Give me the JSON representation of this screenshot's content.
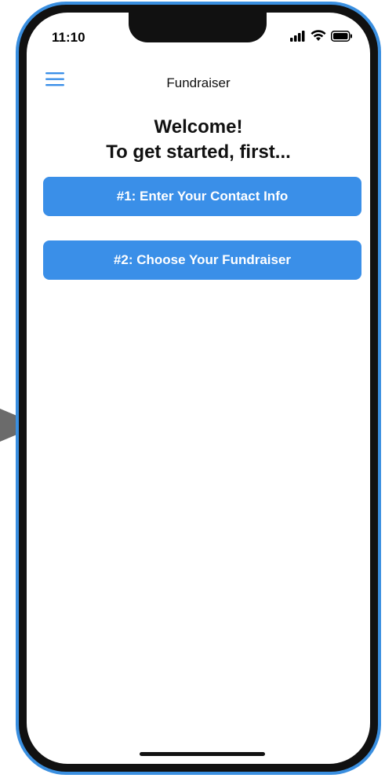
{
  "status_bar": {
    "time": "11:10",
    "icons": [
      "signal-icon",
      "wifi-icon",
      "battery-icon"
    ]
  },
  "nav": {
    "menu_icon": "hamburger-menu-icon",
    "title": "Fundraiser"
  },
  "welcome": {
    "line1": "Welcome!",
    "line2": "To get started, first..."
  },
  "actions": {
    "step1_label": "#1: Enter Your Contact Info",
    "step2_label": "#2: Choose Your Fundraiser"
  },
  "colors": {
    "accent": "#3a8fe8",
    "frame": "#3a8fe0",
    "pointer": "#6b6b6b"
  }
}
